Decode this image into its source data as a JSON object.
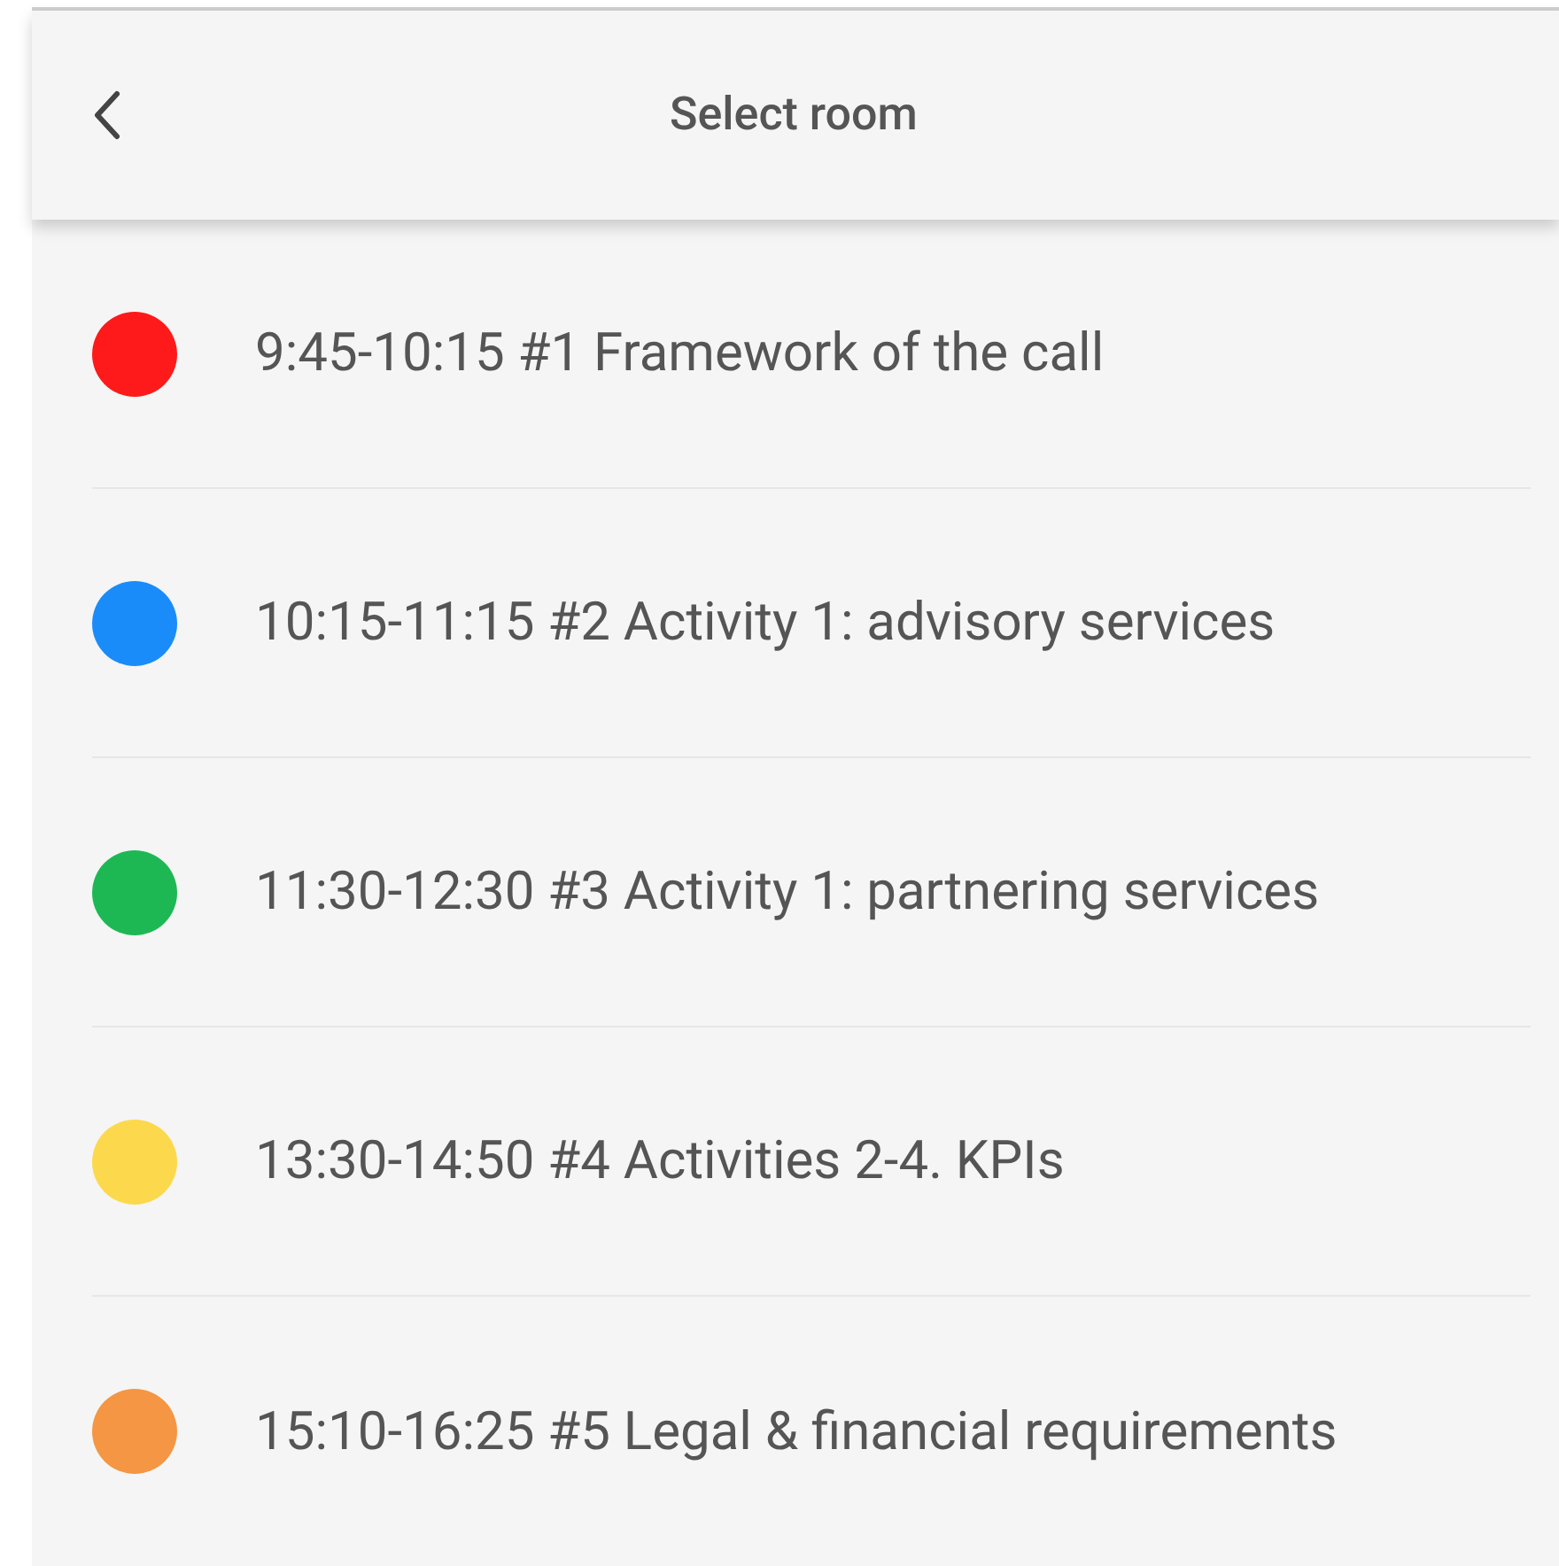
{
  "header": {
    "title": "Select room"
  },
  "rooms": [
    {
      "label": "9:45-10:15 #1 Framework of the call",
      "color": "#fe1a1a"
    },
    {
      "label": "10:15-11:15 #2 Activity 1: advisory services",
      "color": "#1a8cfa"
    },
    {
      "label": "11:30-12:30 #3 Activity 1: partnering services",
      "color": "#1db854"
    },
    {
      "label": "13:30-14:50 #4 Activities 2-4. KPIs",
      "color": "#fcd94c"
    },
    {
      "label": "15:10-16:25 #5 Legal & financial requirements",
      "color": "#f49643"
    }
  ]
}
